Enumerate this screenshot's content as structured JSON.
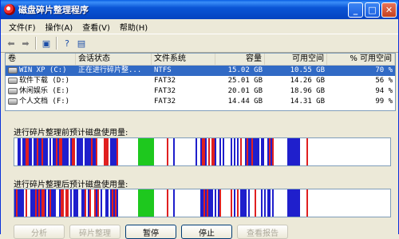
{
  "window": {
    "title": "磁盘碎片整理程序"
  },
  "menubar": [
    "文件(F)",
    "操作(A)",
    "查看(V)",
    "帮助(H)"
  ],
  "list": {
    "headers": [
      "卷",
      "会话状态",
      "文件系统",
      "容量",
      "可用空间",
      "% 可用空间"
    ],
    "rows": [
      {
        "vol": "WIN XP (C:)",
        "status": "正在进行碎片整...",
        "fs": "NTFS",
        "cap": "15.02 GB",
        "free": "10.55 GB",
        "pct": "70 %"
      },
      {
        "vol": "软件下载 (D:)",
        "status": "",
        "fs": "FAT32",
        "cap": "25.01 GB",
        "free": "14.26 GB",
        "pct": "56 %"
      },
      {
        "vol": "休闲娱乐 (E:)",
        "status": "",
        "fs": "FAT32",
        "cap": "20.01 GB",
        "free": "18.96 GB",
        "pct": "94 %"
      },
      {
        "vol": "个人文档 (F:)",
        "status": "",
        "fs": "FAT32",
        "cap": "14.44 GB",
        "free": "14.31 GB",
        "pct": "99 %"
      }
    ]
  },
  "analysis": {
    "before_label": "进行碎片整理前预计磁盘使用量:",
    "after_label": "进行碎片整理后预计磁盘使用量:"
  },
  "buttons": {
    "analyze": "分析",
    "defrag": "碎片整理",
    "pause": "暂停",
    "stop": "停止",
    "report": "查看报告"
  },
  "colors": {
    "fragmented": "#e02020",
    "contiguous": "#1f1fcc",
    "unmovable": "#1ec81e",
    "free": "#ffffff"
  }
}
